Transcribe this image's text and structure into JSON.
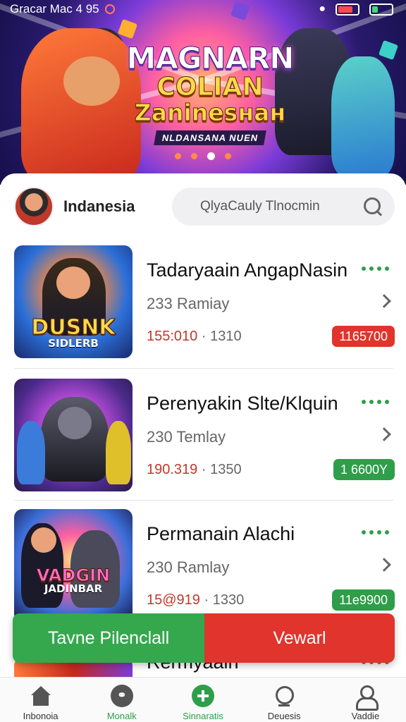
{
  "status_bar": {
    "carrier_time": "Gracar Mac 4 95"
  },
  "banner": {
    "title_line1": "MAGNARN",
    "title_line2": "COLIAN",
    "title_line3": "Zaninesнан",
    "subtitle": "NLDANSANA NUEN",
    "dots": 4,
    "active_dot": 2
  },
  "header": {
    "region": "Indanesia",
    "search_placeholder": "QlyaCauly Tlnocmin"
  },
  "games": [
    {
      "name": "Tadaryaain AngapNasin",
      "players": "233 Ramiay",
      "stat_a": "155:010",
      "stat_b": "1310",
      "badge": "1165700",
      "badge_color": "#e0342c",
      "thumb_logo": "DUSNK",
      "thumb_sub": "SIDLERB"
    },
    {
      "name": "Perenyakin Slte/Klquin",
      "players": "230 Temlay",
      "stat_a": "190.319",
      "stat_b": "1350",
      "badge": "1 6600Y",
      "badge_color": "#2e9e4a"
    },
    {
      "name": "Permanain Alachi",
      "players": "230 Ramlay",
      "stat_a": "15@919",
      "stat_b": "1330",
      "badge": "11e9900",
      "badge_color": "#2e9e4a",
      "thumb_logo": "VADGIN",
      "thumb_sub": "JADINBAR"
    }
  ],
  "partial_game": {
    "name": "Rermyaain"
  },
  "actions": {
    "primary": "Tavne Pilenclall",
    "secondary": "Vewarl"
  },
  "nav": [
    {
      "label": "Inbonoia",
      "icon": "home-icon"
    },
    {
      "label": "Monalk",
      "icon": "disc-icon"
    },
    {
      "label": "Sinnaratis",
      "icon": "add-icon"
    },
    {
      "label": "Deuesis",
      "icon": "search-icon"
    },
    {
      "label": "Vaddie",
      "icon": "user-icon"
    }
  ],
  "colors": {
    "accent_green": "#2e9e4a",
    "accent_red": "#e0342c"
  }
}
